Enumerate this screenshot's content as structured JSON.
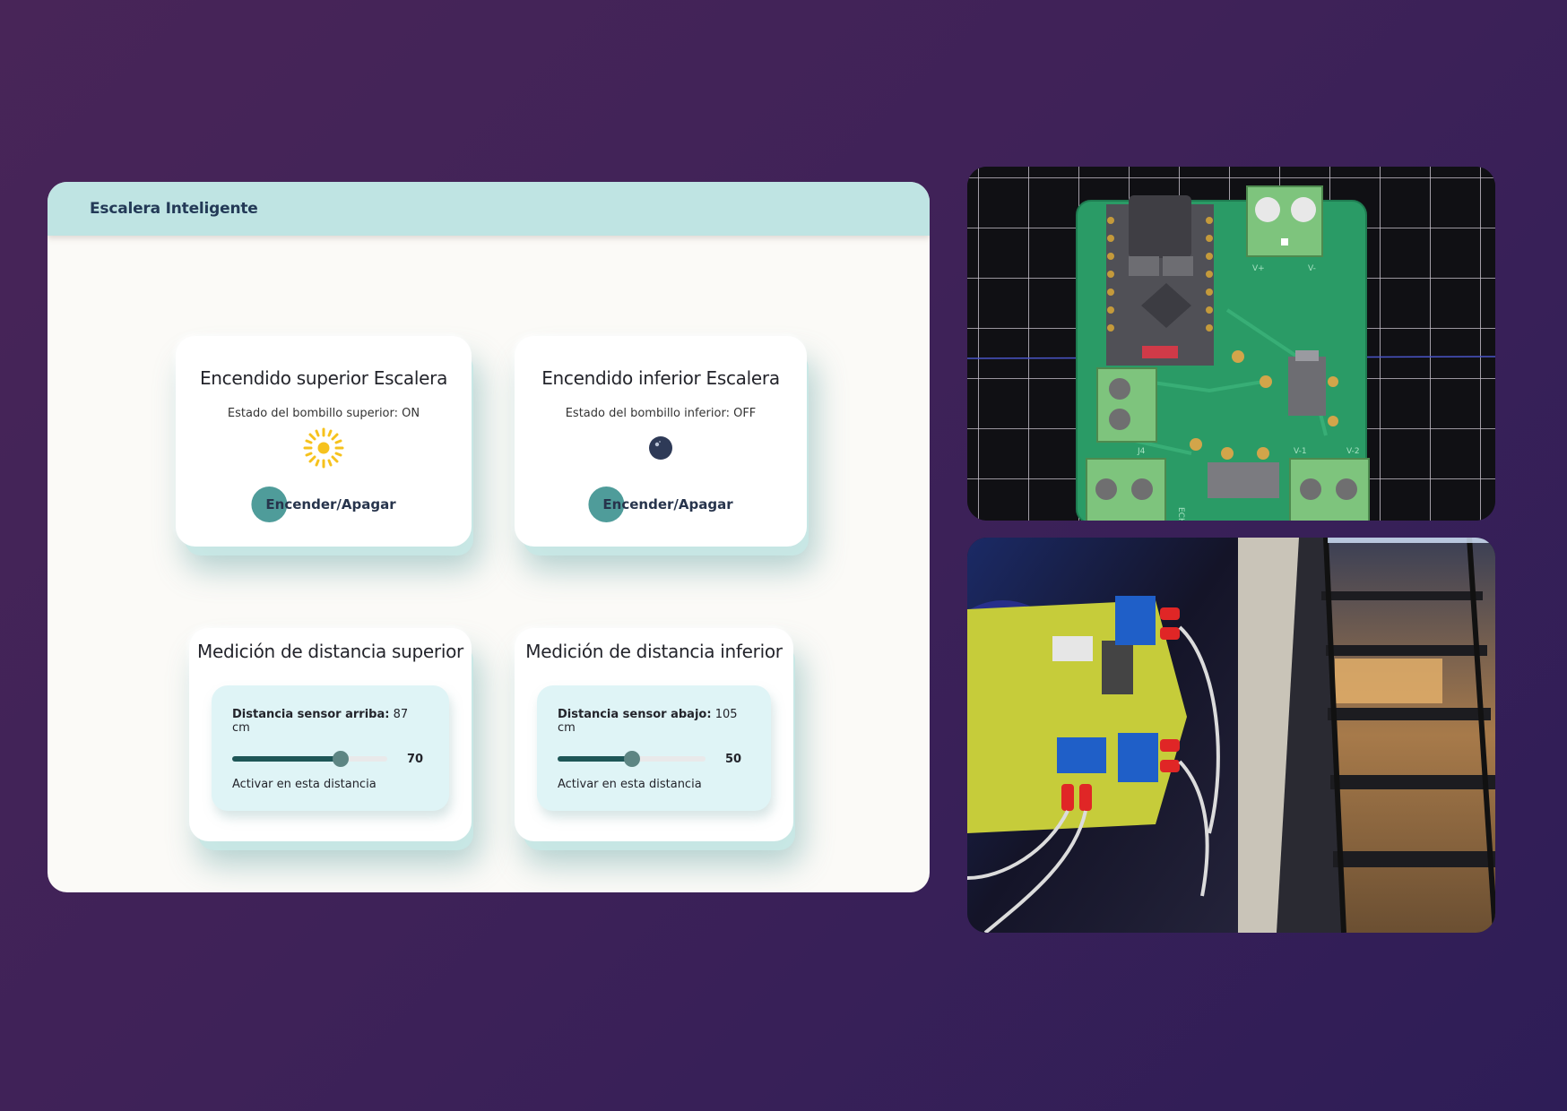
{
  "app": {
    "title": "Escalera Inteligente"
  },
  "light_top": {
    "title": "Encendido superior Escalera",
    "status": "Estado del bombillo superior: ON",
    "icon": "sun-icon",
    "button": "Encender/Apagar"
  },
  "light_bottom": {
    "title": "Encendido inferior Escalera",
    "status": "Estado del bombillo inferior: OFF",
    "icon": "moon-icon",
    "button": "Encender/Apagar"
  },
  "dist_top": {
    "title": "Medición de distancia superior",
    "label": "Distancia sensor arriba:",
    "value": "87 cm",
    "slider_value": 70,
    "slider_display": "70",
    "hint": "Activar en esta distancia"
  },
  "dist_bottom": {
    "title": "Medición de distancia inferior",
    "label": "Distancia sensor abajo:",
    "value": "105 cm",
    "slider_value": 50,
    "slider_display": "50",
    "hint": "Activar en esta distancia"
  },
  "pcb_labels": {
    "v_plus": "V+",
    "v_minus": "V-",
    "v1": "V-1",
    "v2": "V-2",
    "j4": "J4",
    "echo": "ECHO"
  },
  "colors": {
    "background": "#3f2258",
    "header": "#bfe4e3",
    "accent": "#4f9c9a",
    "slider_fill": "#1e5657"
  }
}
